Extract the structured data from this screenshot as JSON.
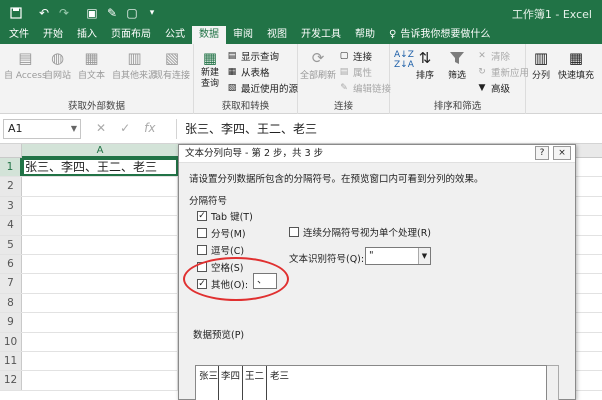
{
  "window": {
    "title": "工作簿1 - Excel"
  },
  "qat": {
    "icons": [
      "save-icon",
      "undo-icon",
      "redo-icon",
      "print-preview-icon",
      "format-painter-icon",
      "new-icon",
      "qat-more-icon"
    ]
  },
  "tabs": [
    {
      "label": "文件"
    },
    {
      "label": "开始"
    },
    {
      "label": "插入"
    },
    {
      "label": "页面布局"
    },
    {
      "label": "公式"
    },
    {
      "label": "数据"
    },
    {
      "label": "审阅"
    },
    {
      "label": "视图"
    },
    {
      "label": "开发工具"
    },
    {
      "label": "帮助"
    }
  ],
  "tell_me": {
    "label": "告诉我你想要做什么"
  },
  "ribbon": {
    "get_external": {
      "label": "获取外部数据",
      "buttons": [
        "自 Access",
        "自网站",
        "自文本",
        "自其他来源",
        "现有连接"
      ]
    },
    "get_transform": {
      "label": "获取和转换",
      "new_query": "新建\n查询",
      "items": [
        "显示查询",
        "从表格",
        "最近使用的源"
      ]
    },
    "connections": {
      "label": "连接",
      "refresh_all": "全部刷新",
      "items": [
        "连接",
        "属性",
        "编辑链接"
      ]
    },
    "sort_filter": {
      "label": "排序和筛选",
      "sort": "排序",
      "filter": "筛选",
      "items": [
        "清除",
        "重新应用",
        "高级"
      ]
    },
    "tools": {
      "split": "分列",
      "flash_fill": "快速填充"
    }
  },
  "formula_bar": {
    "name_box": "A1",
    "content": "张三、李四、王二、老三"
  },
  "sheet": {
    "col_a": "A",
    "rows": [
      "1",
      "2",
      "3",
      "4",
      "5",
      "6",
      "7",
      "8",
      "9",
      "10",
      "11",
      "12"
    ],
    "a1": "张三、李四、王二、老三"
  },
  "dialog": {
    "title": "文本分列向导 - 第 2 步，共 3 步",
    "help": "?",
    "close": "×",
    "description": "请设置分列数据所包含的分隔符号。在预览窗口内可看到分列的效果。",
    "group_label": "分隔符号",
    "options": [
      {
        "label": "Tab 键(T)",
        "checked": true
      },
      {
        "label": "分号(M)",
        "checked": false
      },
      {
        "label": "逗号(C)",
        "checked": false
      },
      {
        "label": "空格(S)",
        "checked": false
      },
      {
        "label": "其他(O):",
        "checked": true
      }
    ],
    "other_value": "、",
    "consecutive": "连续分隔符号视为单个处理(R)",
    "qualifier_label": "文本识别符号(Q):",
    "qualifier_value": "\"",
    "preview_label": "数据预览(P)",
    "preview_cols": [
      "张三",
      "李四",
      "王二",
      "老三"
    ]
  }
}
